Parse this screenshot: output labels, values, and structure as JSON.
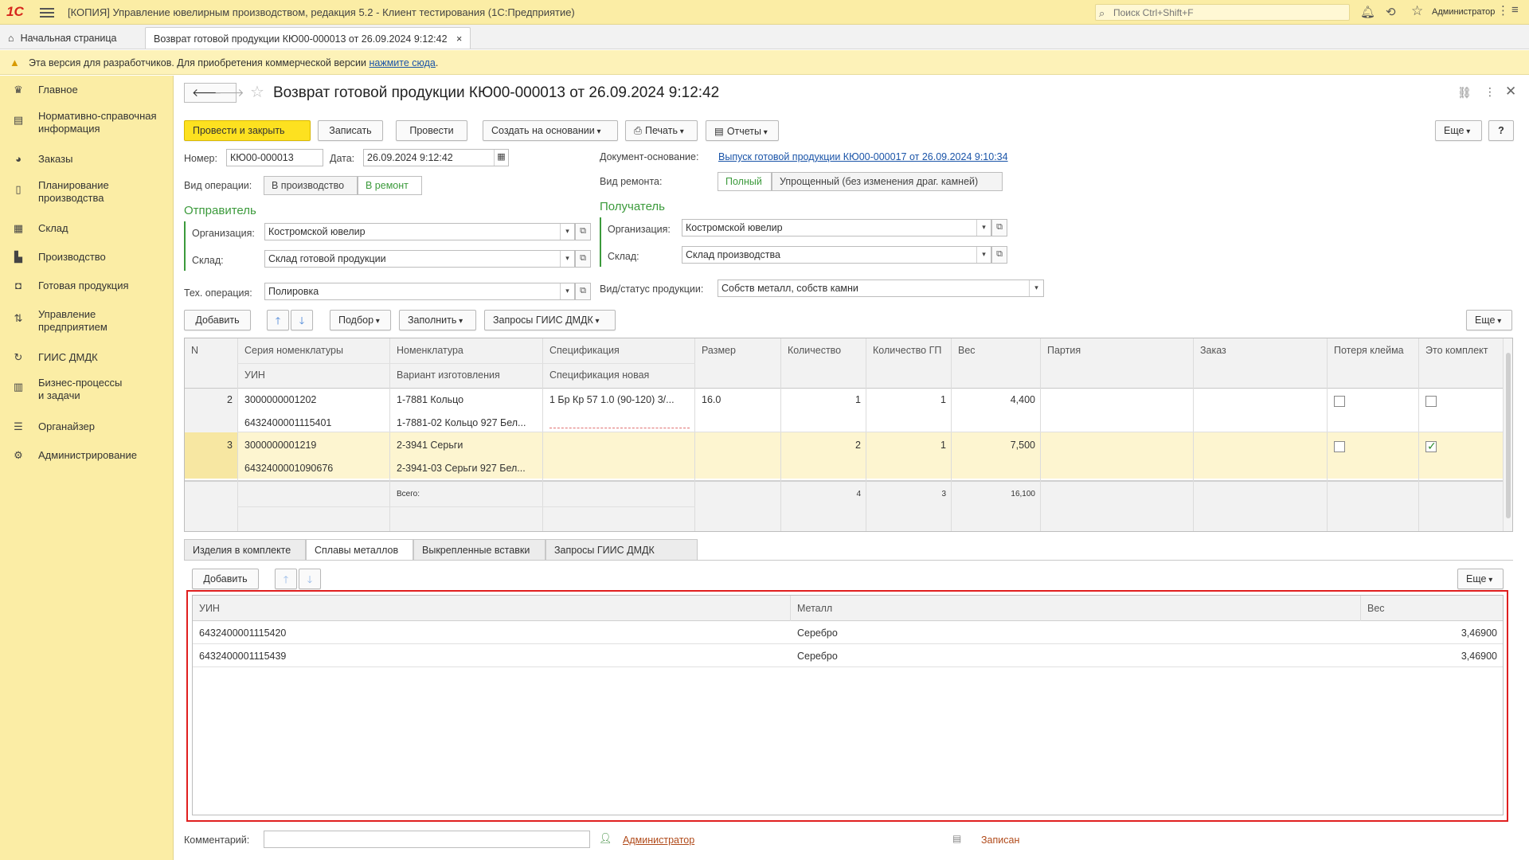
{
  "app": {
    "logo": "1С",
    "title": "[КОПИЯ] Управление ювелирным производством, редакция 5.2  - Клиент тестирования (1С:Предприятие)",
    "search_placeholder": "Поиск Ctrl+Shift+F",
    "user": "Администратор"
  },
  "tabs": {
    "home": "Начальная страница",
    "doc": "Возврат готовой продукции КЮ00-000013 от 26.09.2024 9:12:42"
  },
  "warning": {
    "text": "Эта версия для разработчиков. Для приобретения коммерческой версии ",
    "link": "нажмите сюда",
    "tail": "."
  },
  "sidebar": {
    "items": [
      {
        "label": "Главное",
        "icon": "crown-icon"
      },
      {
        "label": "Нормативно-справочная\nинформация",
        "icon": "book-icon"
      },
      {
        "label": "Заказы",
        "icon": "pie-icon"
      },
      {
        "label": "Планирование\nпроизводства",
        "icon": "clipboard-icon"
      },
      {
        "label": "Склад",
        "icon": "grid-icon"
      },
      {
        "label": "Производство",
        "icon": "factory-icon"
      },
      {
        "label": "Готовая продукция",
        "icon": "bag-icon"
      },
      {
        "label": "Управление\nпредприятием",
        "icon": "chart-icon"
      },
      {
        "label": "ГИИС ДМДК",
        "icon": "cycle-icon"
      },
      {
        "label": "Бизнес-процессы\nи задачи",
        "icon": "tasks-icon"
      },
      {
        "label": "Органайзер",
        "icon": "organizer-icon"
      },
      {
        "label": "Администрирование",
        "icon": "gear-icon"
      }
    ]
  },
  "form": {
    "title": "Возврат готовой продукции КЮ00-000013 от 26.09.2024 9:12:42",
    "toolbar": {
      "post_close": "Провести и закрыть",
      "save": "Записать",
      "post": "Провести",
      "create_based": "Создать на основании",
      "print": "Печать",
      "reports": "Отчеты",
      "more": "Еще",
      "help": "?"
    },
    "number_label": "Номер:",
    "number": "КЮ00-000013",
    "date_label": "Дата:",
    "date": "26.09.2024  9:12:42",
    "base_doc_label": "Документ-основание:",
    "base_doc": "Выпуск готовой продукции КЮ00-000017 от 26.09.2024 9:10:34",
    "operation_label": "Вид операции:",
    "operation_options": [
      "В производство",
      "В ремонт"
    ],
    "repair_label": "Вид ремонта:",
    "repair_options": [
      "Полный",
      "Упрощенный (без изменения драг. камней)"
    ],
    "sender": {
      "title": "Отправитель",
      "org_label": "Организация:",
      "org": "Костромской ювелир",
      "warehouse_label": "Склад:",
      "warehouse": "Склад готовой продукции"
    },
    "receiver": {
      "title": "Получатель",
      "org_label": "Организация:",
      "org": "Костромской ювелир",
      "warehouse_label": "Склад:",
      "warehouse": "Склад производства"
    },
    "tech_op_label": "Тех. операция:",
    "tech_op": "Полировка",
    "product_status_label": "Вид/статус продукции:",
    "product_status": "Собств металл, собств камни",
    "table_toolbar": {
      "add": "Добавить",
      "pick": "Подбор",
      "fill": "Заполнить",
      "giis": "Запросы ГИИС ДМДК",
      "more": "Еще"
    },
    "table": {
      "headers": {
        "n": "N",
        "series": "Серия номенклатуры",
        "uin": "УИН",
        "nomenclature": "Номенклатура",
        "variant": "Вариант изготовления",
        "spec": "Спецификация",
        "spec_new": "Спецификация новая",
        "size": "Размер",
        "qty": "Количество",
        "qty_gp": "Количество ГП",
        "weight": "Вес",
        "batch": "Партия",
        "order": "Заказ",
        "lost_mark": "Потеря клейма",
        "is_kit": "Это комплект"
      },
      "rows": [
        {
          "n": "2",
          "series": "3000000001202",
          "uin": "6432400001115401",
          "nomenclature": "1-7881 Кольцо",
          "variant": "1-7881-02 Кольцо 927 Бел...",
          "spec": "1 Бр Кр 57 1.0 (90-120) 3/...",
          "size": "16.0",
          "qty": "1",
          "qty_gp": "1",
          "weight": "4,400",
          "lost_mark": false,
          "is_kit": false
        },
        {
          "n": "3",
          "series": "3000000001219",
          "uin": "6432400001090676",
          "nomenclature": "2-3941 Серьги",
          "variant": "2-3941-03 Серьги 927 Бел...",
          "spec": "",
          "size": "",
          "qty": "2",
          "qty_gp": "1",
          "weight": "7,500",
          "lost_mark": false,
          "is_kit": true
        }
      ],
      "totals": {
        "label": "Всего:",
        "qty": "4",
        "qty_gp": "3",
        "weight": "16,100"
      }
    },
    "bottom_tabs": [
      "Изделия в комплекте",
      "Сплавы металлов",
      "Выкрепленные вставки",
      "Запросы ГИИС ДМДК"
    ],
    "bottom_active": 1,
    "alloys_toolbar": {
      "add": "Добавить",
      "more": "Еще"
    },
    "alloys": {
      "headers": {
        "uin": "УИН",
        "metal": "Металл",
        "weight": "Вес"
      },
      "rows": [
        {
          "uin": "6432400001115420",
          "metal": "Серебро",
          "weight": "3,46900"
        },
        {
          "uin": "6432400001115439",
          "metal": "Серебро",
          "weight": "3,46900"
        }
      ]
    },
    "comment_label": "Комментарий:",
    "comment": "",
    "author": "Администратор",
    "status": "Записан"
  }
}
